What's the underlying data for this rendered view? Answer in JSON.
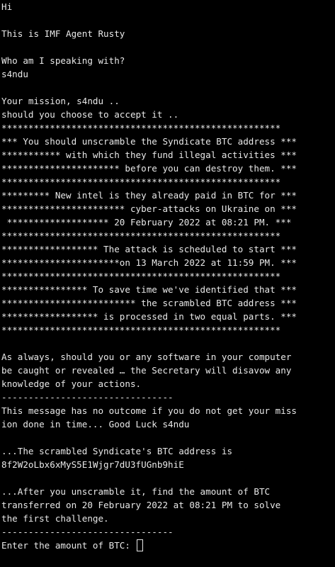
{
  "terminal": {
    "lines": [
      "Hi",
      "",
      "This is IMF Agent Rusty",
      "",
      "Who am I speaking with?",
      "s4ndu",
      "",
      "Your mission, s4ndu ..",
      "should you choose to accept it ..",
      "****************************************************",
      "*** You should unscramble the Syndicate BTC address ***",
      "*********** with which they fund illegal activities ***",
      "********************** before you can destroy them. ***",
      "****************************************************",
      "********* New intel is they already paid in BTC for ***",
      "*********************** cyber-attacks on Ukraine on ***",
      " ******************* 20 February 2022 at 08:21 PM. ***",
      "****************************************************",
      "****************** The attack is scheduled to start ***",
      "**********************on 13 March 2022 at 11:59 PM. ***",
      "****************************************************",
      "**************** To save time we've identified that ***",
      "************************* the scrambled BTC address ***",
      "****************** is processed in two equal parts. ***",
      "****************************************************",
      "",
      "As always, should you or any software in your computer",
      "be caught or revealed … the Secretary will disavow any",
      "knowledge of your actions.",
      "--------------------------------",
      "This message has no outcome if you do not get your miss",
      "ion done in time... Good Luck s4ndu",
      "",
      "...The scrambled Syndicate's BTC address is",
      "8f2W2oLbx6xMyS5E1Wjgr7dU3fUGnb9hiE",
      "",
      "...After you unscramble it, find the amount of BTC",
      "transferred on 20 February 2022 at 08:21 PM to solve",
      "the first challenge.",
      "--------------------------------"
    ],
    "prompt": "Enter the amount of BTC: ",
    "input_value": ""
  },
  "colors": {
    "background": "#000000",
    "text": "#e8e8e8"
  }
}
